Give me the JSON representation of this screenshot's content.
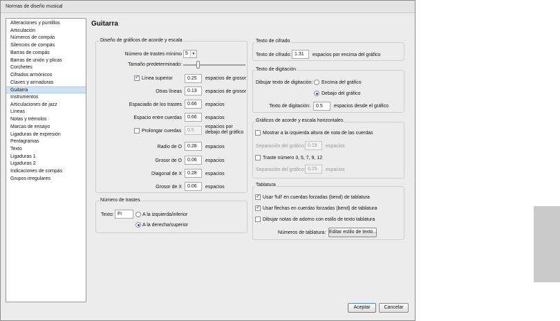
{
  "window": {
    "title": "Normas de diseño musical"
  },
  "page_title": "Guitarra",
  "sidebar": {
    "items": [
      "Alteraciones y puntillos",
      "Articulación",
      "Números de compás",
      "Silencios de compás",
      "Barras de compás",
      "Barras de unión y plicas",
      "Corchetes",
      "Cifrados armónicos",
      "Claves y armaduras",
      "Guitarra",
      "Instrumentos",
      "Articulaciones de jazz",
      "Líneas",
      "Notas y trémolos",
      "Marcas de ensayo",
      "Ligaduras de expresión",
      "Pentagramas",
      "Texto",
      "Ligaduras 1",
      "Ligaduras 2",
      "Indicaciones de compás",
      "Grupos irregulares"
    ],
    "selected_index": 9
  },
  "chord": {
    "title": "Diseño de gráficos de acorde y escala",
    "min_frets_label": "Número de trastes mínimo",
    "min_frets_value": "5",
    "default_size_label": "Tamaño predeterminado:",
    "default_size_level": 0.45,
    "top_line_label": "Línea superior",
    "top_line_checked": true,
    "top_line_value": "0.25",
    "top_line_unit": "espacios de grosor",
    "other_lines_label": "Otras líneas",
    "other_lines_value": "0.13",
    "other_lines_unit": "espacios de grosor",
    "fret_spacing_label": "Espaciado de los trastes",
    "fret_spacing_value": "0.66",
    "fret_spacing_unit": "espacios",
    "string_spacing_label": "Espacio entre cuerdas",
    "string_spacing_value": "0.66",
    "string_spacing_unit": "espacios",
    "extend_strings_label": "Prolongar cuerdas",
    "extend_strings_checked": false,
    "extend_strings_value": "0.5",
    "extend_strings_unit": "espacios por debajo del gráfico",
    "radius_o_label": "Radio de O",
    "radius_o_value": "0.28",
    "radius_o_unit": "espacios",
    "thickness_o_label": "Grosor de O",
    "thickness_o_value": "0.06",
    "thickness_o_unit": "espacios",
    "diagonal_x_label": "Diagonal de X",
    "diagonal_x_value": "0.28",
    "diagonal_x_unit": "espacios",
    "thickness_x_label": "Grosor de X",
    "thickness_x_value": "0.06",
    "thickness_x_unit": "espacios"
  },
  "frets": {
    "title": "Número de trastes",
    "text_label": "Texto:",
    "text_value": "Fr",
    "left_label": "A la izquierda/inferior",
    "right_label": "A la derecha/superior",
    "selected": "right"
  },
  "cifrado": {
    "title": "Texto de cifrado",
    "label": "Texto de cifrado:",
    "value": "1.31",
    "unit": "espacios por encima del gráfico"
  },
  "digitacion": {
    "title": "Texto de digitación",
    "draw_label": "Dibujar texto de digitación:",
    "above_label": "Encima del gráfico",
    "below_label": "Debajo del gráfico",
    "selected": "below",
    "text_label": "Texto de digitación:",
    "text_value": "0.5",
    "text_unit": "espacios desde el gráfico"
  },
  "horizontal": {
    "title": "Gráficos de acorde y escala horizontales",
    "show_height_label": "Mostrar a la izquierda altura de nota de las cuerdas",
    "show_height_checked": false,
    "sep1_label": "Separación del gráfico:",
    "sep1_value": "0.19",
    "sep1_unit": "espacios",
    "fret_numbers_label": "Traste número 3, 5, 7, 9, 12",
    "fret_numbers_checked": false,
    "sep2_label": "Separación del gráfico:",
    "sep2_value": "0.25",
    "sep2_unit": "espacios"
  },
  "tablatura": {
    "title": "Tablatura",
    "full_label": "Usar 'full' en cuerdas forzadas (bend) de tablatura",
    "full_checked": true,
    "arrows_label": "Usar flechas en cuerdas forzadas (bend) de tablatura",
    "arrows_checked": true,
    "ornament_label": "Dibujar notas de adorno con estilo de texto tablatura",
    "ornament_checked": false,
    "numbers_label": "Números de tablatura:",
    "edit_style_button": "Editar estilo de texto..."
  },
  "footer": {
    "ok": "Aceptar",
    "cancel": "Cancelar"
  }
}
